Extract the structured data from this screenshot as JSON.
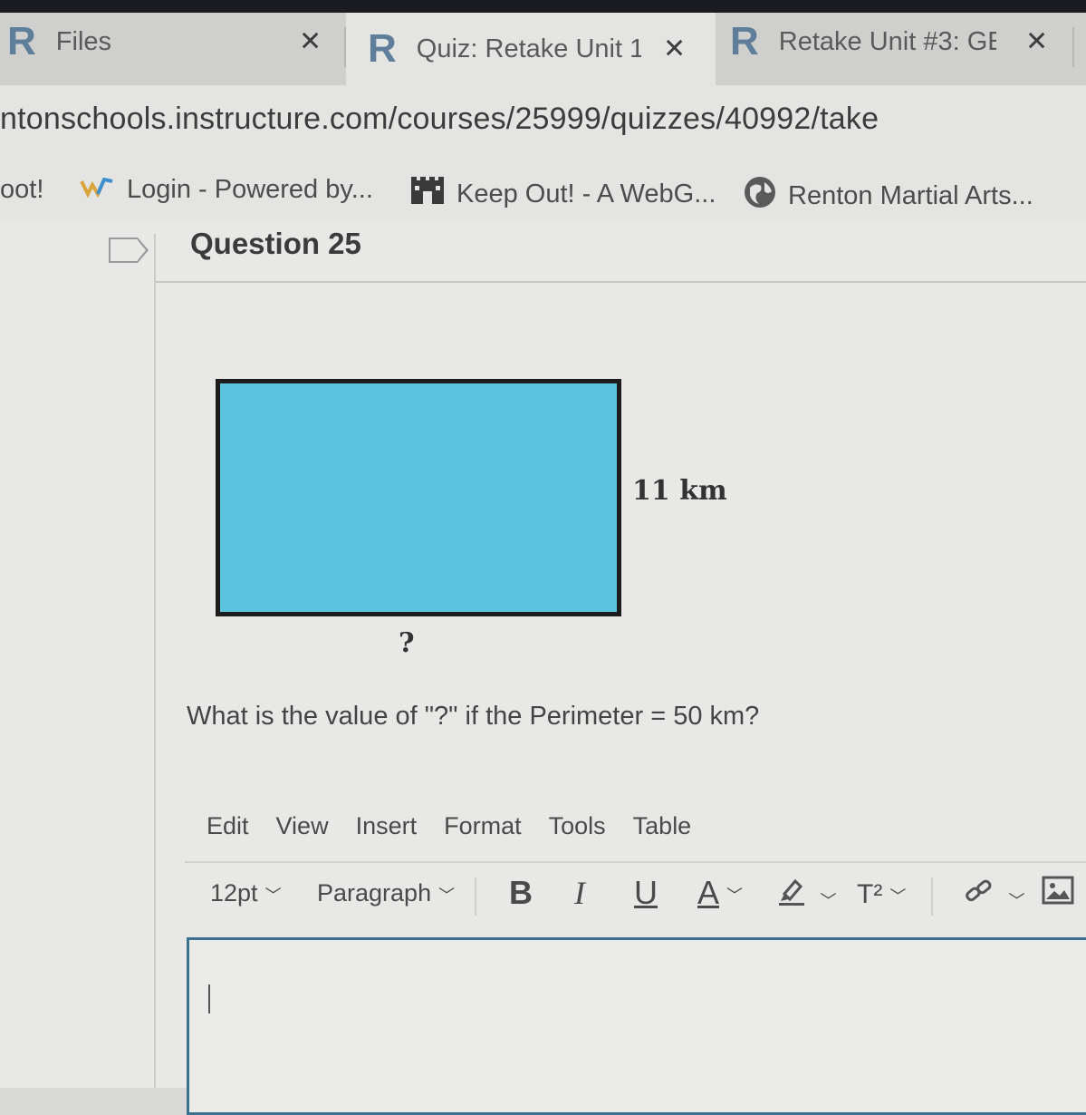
{
  "tabs": [
    {
      "logo": "R",
      "title": "Files"
    },
    {
      "logo": "R",
      "title": "Quiz: Retake Unit 1/"
    },
    {
      "logo": "R",
      "title": "Retake Unit #3: GE("
    }
  ],
  "address": {
    "url": "ntonschools.instructure.com/courses/25999/quizzes/40992/take"
  },
  "bookmarks": [
    {
      "label": "oot!"
    },
    {
      "label": "Login - Powered by...",
      "icon": "w-logo-icon"
    },
    {
      "label": "Keep Out! - A WebG...",
      "icon": "castle-icon"
    },
    {
      "label": "Renton Martial Arts...",
      "icon": "globe-icon"
    }
  ],
  "question": {
    "title": "Question 25",
    "side_label": "11 km",
    "bottom_label": "?",
    "prompt": "What is the value of \"?\" if the Perimeter = 50 km?"
  },
  "editor": {
    "menu": [
      "Edit",
      "View",
      "Insert",
      "Format",
      "Tools",
      "Table"
    ],
    "font_size": "12pt",
    "block_format": "Paragraph",
    "bold": "B",
    "italic": "I",
    "underline": "U",
    "text_color": "A",
    "superscript": "T²"
  },
  "colors": {
    "rect_fill": "#5cc3df",
    "logo": "#5e7e9a",
    "editor_border": "#3d6f8f"
  }
}
